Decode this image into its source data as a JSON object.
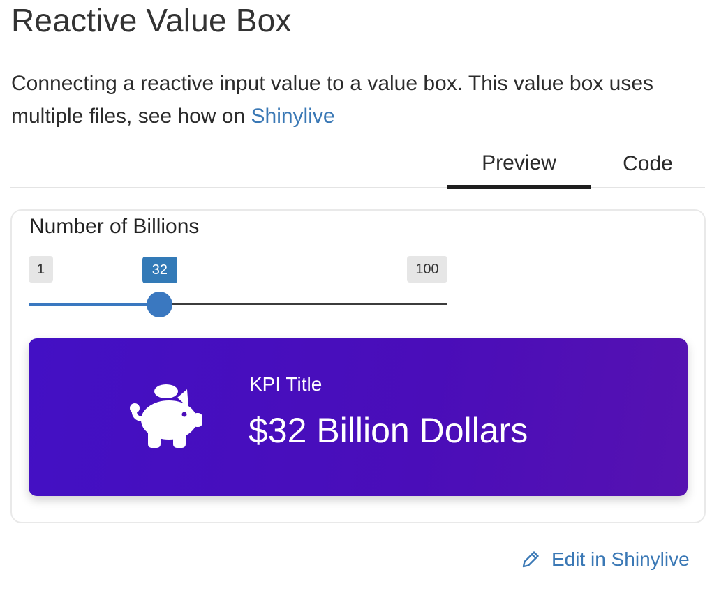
{
  "page": {
    "title": "Reactive Value Box",
    "intro_text": "Connecting a reactive input value to a value box. This value box uses multiple files, see how on ",
    "intro_link": "Shinylive"
  },
  "tabs": [
    {
      "label": "Preview",
      "active": true
    },
    {
      "label": "Code",
      "active": false
    }
  ],
  "slider": {
    "label": "Number of Billions",
    "min": 1,
    "max": 100,
    "value": 32,
    "min_label": "1",
    "max_label": "100",
    "value_label": "32"
  },
  "value_box": {
    "icon": "piggy-bank-icon",
    "title": "KPI Title",
    "value": "$32 Billion Dollars"
  },
  "edit_link": {
    "label": "Edit in Shinylive",
    "icon": "pencil-icon"
  },
  "colors": {
    "link": "#3a78b5",
    "slider_accent": "#337ab7",
    "value_box_bg": "#4310c4"
  }
}
